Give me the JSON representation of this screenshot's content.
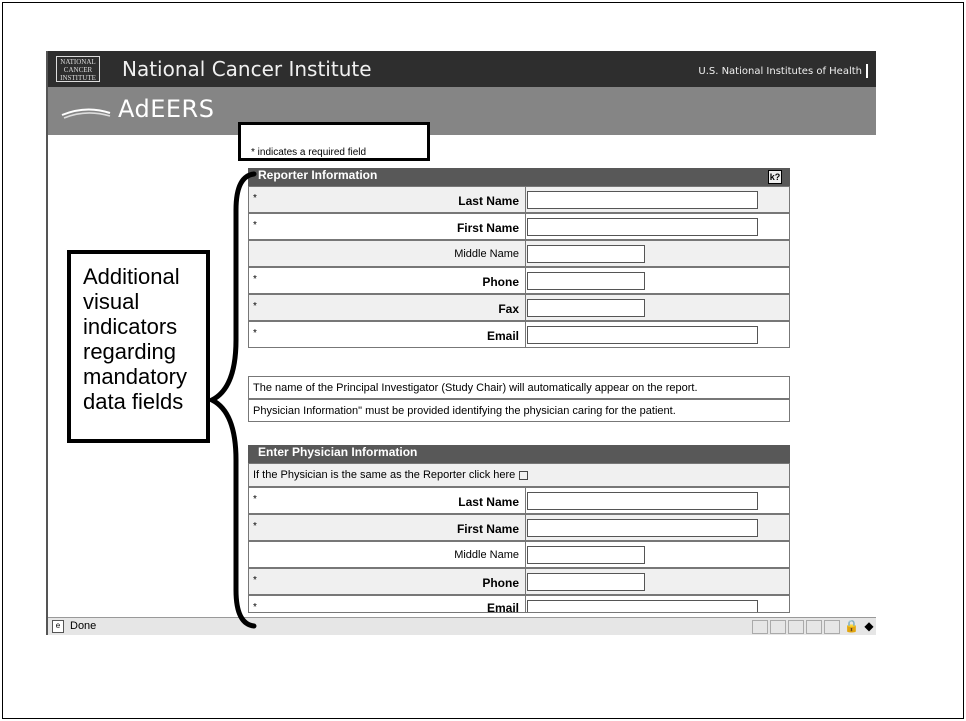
{
  "header": {
    "logo_text": "NATIONAL CANCER INSTITUTE",
    "org_title": "National Cancer Institute",
    "nih_link": "U.S. National Institutes of Health",
    "app_name": "AdEERS"
  },
  "required_note": "* indicates a required field",
  "reporter": {
    "title": "Reporter Information",
    "help_icon_label": "k?",
    "rows": [
      {
        "required": "*",
        "label": "Last Name",
        "value": ""
      },
      {
        "required": "*",
        "label": "First Name",
        "value": ""
      },
      {
        "required": "",
        "label": "Middle Name",
        "value": ""
      },
      {
        "required": "*",
        "label": "Phone",
        "value": ""
      },
      {
        "required": "*",
        "label": "Fax",
        "value": ""
      },
      {
        "required": "*",
        "label": "Email",
        "value": ""
      }
    ]
  },
  "info_lines": [
    "The name of the Principal Investigator (Study Chair) will automatically appear on the report.",
    "Physician Information\" must be provided identifying the physician caring for the patient."
  ],
  "physician": {
    "title": "Enter Physician Information",
    "same_as_text": "If the Physician is the same as the Reporter click here",
    "same_as_checked": false,
    "rows": [
      {
        "required": "*",
        "label": "Last Name",
        "value": ""
      },
      {
        "required": "*",
        "label": "First Name",
        "value": ""
      },
      {
        "required": "",
        "label": "Middle Name",
        "value": ""
      },
      {
        "required": "*",
        "label": "Phone",
        "value": ""
      },
      {
        "required": "*",
        "label": "Email",
        "value": ""
      }
    ]
  },
  "statusbar": {
    "text": "Done"
  },
  "callout": {
    "text": "Additional visual indicators regarding mandatory data fields"
  },
  "colors": {
    "topbar": "#2e2e2e",
    "appbar": "#858585",
    "section_header": "#585858",
    "row_alt": "#f0f0f0"
  }
}
